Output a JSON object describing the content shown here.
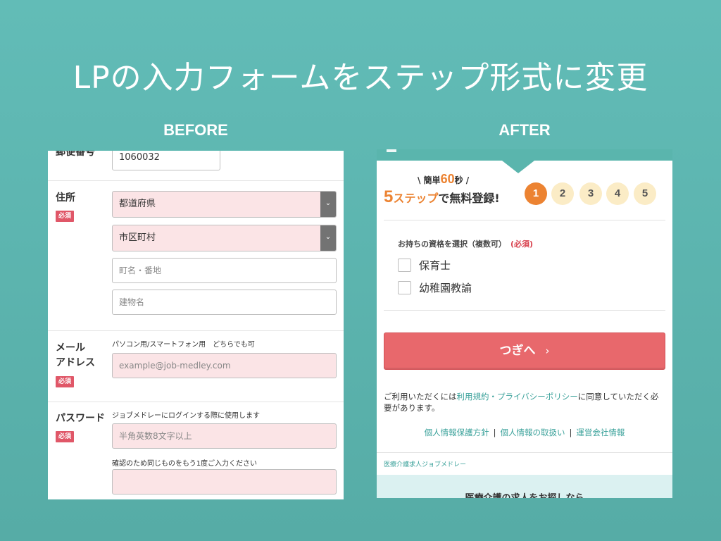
{
  "title": "LPの入力フォームをステップ形式に変更",
  "labels": {
    "before": "BEFORE",
    "after": "AFTER"
  },
  "before": {
    "postal": {
      "label": "郵便番号",
      "value": "1060032"
    },
    "address": {
      "label": "住所",
      "required": "必須",
      "prefecture": "都道府県",
      "city": "市区町村",
      "town_placeholder": "町名・番地",
      "building_placeholder": "建物名"
    },
    "email": {
      "label_line1": "メール",
      "label_line2": "アドレス",
      "required": "必須",
      "hint": "パソコン用/スマートフォン用　どちらでも可",
      "placeholder": "example@job-medley.com"
    },
    "password": {
      "label": "パスワード",
      "required": "必須",
      "hint": "ジョブメドレーにログインする際に使用します",
      "placeholder": "半角英数8文字以上",
      "confirm_hint": "確認のため同じものをもう1度ご入力ください"
    }
  },
  "after": {
    "easy_prefix": "\\ 簡単",
    "easy_num": "60",
    "easy_suffix": "秒 /",
    "steps_num": "5",
    "steps_word": "ステップ",
    "steps_rest": "で無料登録!",
    "steps": [
      "1",
      "2",
      "3",
      "4",
      "5"
    ],
    "active_step": 1,
    "question": "お持ちの資格を選択（複数可）",
    "question_required": "(必須)",
    "options": [
      "保育士",
      "幼稚園教諭"
    ],
    "next_label": "つぎへ",
    "next_chevron": "›",
    "agree_prefix": "ご利用いただくには",
    "agree_link": "利用規約・プライバシーポリシー",
    "agree_suffix": "に同意していただく必要があります。",
    "links": [
      "個人情報保護方針",
      "個人情報の取扱い",
      "運営会社情報"
    ],
    "link_sep": "|",
    "brand": "医療介護求人ジョブメドレー",
    "footer_text": "医療介護の求人をお探しなら"
  },
  "colors": {
    "background": "#5ab5ad",
    "accent_orange": "#ec8332",
    "button_red": "#e8686c",
    "required_red": "#e05768",
    "link_teal": "#3aa19a",
    "pink_field": "#fbe4e6"
  }
}
